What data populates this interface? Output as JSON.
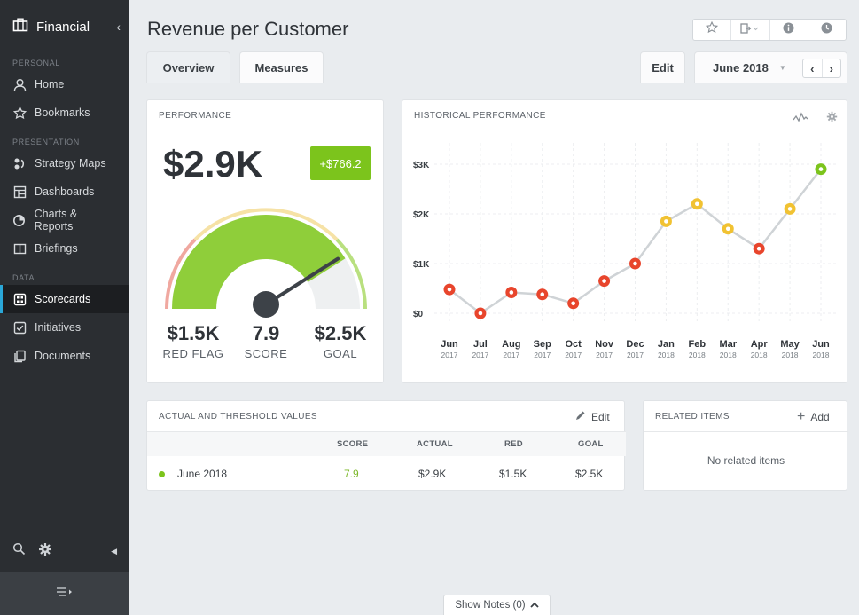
{
  "sidebar": {
    "title": "Financial",
    "sections": {
      "personal": "PERSONAL",
      "presentation": "PRESENTATION",
      "data": "DATA"
    },
    "items": {
      "home": "Home",
      "bookmarks": "Bookmarks",
      "strategy_maps": "Strategy Maps",
      "dashboards": "Dashboards",
      "charts_reports": "Charts & Reports",
      "briefings": "Briefings",
      "scorecards": "Scorecards",
      "initiatives": "Initiatives",
      "documents": "Documents"
    },
    "active": "scorecards"
  },
  "header": {
    "title": "Revenue per Customer",
    "tabs": {
      "overview": "Overview",
      "measures": "Measures"
    },
    "edit_label": "Edit",
    "period": "June 2018",
    "tools": [
      "star-icon",
      "export-icon",
      "info-icon",
      "clock-icon"
    ]
  },
  "performance": {
    "title": "PERFORMANCE",
    "value": "$2.9K",
    "delta": "+$766.2",
    "gauge_fraction": 0.82,
    "red_flag_value": "$1.5K",
    "red_flag_label": "RED FLAG",
    "score_value": "7.9",
    "score_label": "SCORE",
    "goal_value": "$2.5K",
    "goal_label": "GOAL"
  },
  "history": {
    "title": "HISTORICAL PERFORMANCE"
  },
  "chart_data": {
    "type": "line",
    "title": "HISTORICAL PERFORMANCE",
    "xlabel": "",
    "ylabel": "",
    "ylim": [
      0,
      3000
    ],
    "yticks": [
      "$0",
      "$1K",
      "$2K",
      "$3K"
    ],
    "ytick_values": [
      0,
      1000,
      2000,
      3000
    ],
    "x_months": [
      "Jun",
      "Jul",
      "Aug",
      "Sep",
      "Oct",
      "Nov",
      "Dec",
      "Jan",
      "Feb",
      "Mar",
      "Apr",
      "May",
      "Jun"
    ],
    "x_years": [
      "2017",
      "2017",
      "2017",
      "2017",
      "2017",
      "2017",
      "2017",
      "2018",
      "2018",
      "2018",
      "2018",
      "2018",
      "2018"
    ],
    "values": [
      480,
      0,
      420,
      380,
      200,
      650,
      1000,
      1850,
      2200,
      1700,
      1300,
      2100,
      2900
    ],
    "status": [
      "red",
      "red",
      "red",
      "red",
      "red",
      "red",
      "red",
      "yellow",
      "yellow",
      "yellow",
      "red",
      "yellow",
      "green"
    ],
    "grid": true,
    "colors": {
      "red": "#e8452c",
      "yellow": "#f1c232",
      "green": "#7cc41c",
      "line": "#cfd3d6"
    }
  },
  "actuals": {
    "title": "ACTUAL AND THRESHOLD VALUES",
    "edit_label": "Edit",
    "columns": [
      "SCORE",
      "ACTUAL",
      "RED",
      "GOAL"
    ],
    "rows": [
      {
        "period": "June 2018",
        "score": "7.9",
        "actual": "$2.9K",
        "red": "$1.5K",
        "goal": "$2.5K"
      }
    ]
  },
  "related": {
    "title": "RELATED ITEMS",
    "add_label": "Add",
    "empty": "No related items"
  },
  "footer": {
    "show_notes": "Show Notes (0)"
  }
}
